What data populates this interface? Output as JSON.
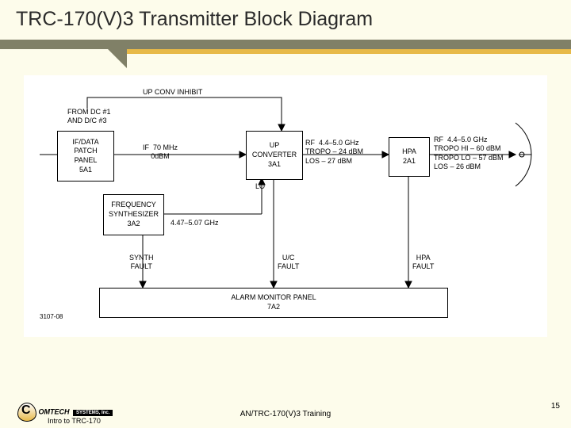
{
  "title": "TRC-170(V)3 Transmitter Block Diagram",
  "blocks": {
    "patch": {
      "l1": "IF/DATA",
      "l2": "PATCH",
      "l3": "PANEL",
      "l4": "5A1"
    },
    "synth": {
      "l1": "FREQUENCY",
      "l2": "SYNTHESIZER",
      "l3": "3A2"
    },
    "upconv": {
      "l1": "UP",
      "l2": "CONVERTER",
      "l3": "3A1"
    },
    "hpa": {
      "l1": "HPA",
      "l2": "2A1"
    },
    "alarm": {
      "l1": "ALARM MONITOR PANEL",
      "l2": "7A2"
    }
  },
  "notes": {
    "from": "FROM DC #1\nAND D/C #3",
    "inhibit": "UP CONV INHIBIT",
    "if70": "IF  70 MHz\n0dBM",
    "lo": "LO",
    "lofreq": "4.47–5.07 GHz",
    "postup": "RF  4.4–5.0 GHz\nTROPO – 24 dBM\nLOS – 27 dBM",
    "posthpa": "RF  4.4–5.0 GHz\nTROPO HI – 60 dBM\nTROPO LO – 57 dBM\nLOS – 26 dBM",
    "f_synth": "SYNTH\nFAULT",
    "f_uc": "U/C\nFAULT",
    "f_hpa": "HPA\nFAULT",
    "figno": "3107-08"
  },
  "footer": {
    "brand": "OMTECH",
    "sub": "SYSTEMS, Inc.",
    "left": "Intro to TRC-170",
    "center": "AN/TRC-170(V)3 Training",
    "page": "15"
  },
  "chart_data": {
    "type": "diagram",
    "title": "TRC-170(V)3 Transmitter Block Diagram",
    "nodes": [
      {
        "id": "5A1",
        "label": "IF/DATA PATCH PANEL 5A1",
        "inputs": [
          "FROM DC #1 AND D/C #3"
        ]
      },
      {
        "id": "3A2",
        "label": "FREQUENCY SYNTHESIZER 3A2",
        "output": "LO 4.47–5.07 GHz"
      },
      {
        "id": "3A1",
        "label": "UP CONVERTER 3A1"
      },
      {
        "id": "2A1",
        "label": "HPA 2A1"
      },
      {
        "id": "7A2",
        "label": "ALARM MONITOR PANEL 7A2"
      },
      {
        "id": "ANT",
        "label": "Antenna"
      }
    ],
    "edges": [
      {
        "from": "5A1",
        "to": "3A1",
        "label": "IF 70 MHz, 0 dBM"
      },
      {
        "from": "3A2",
        "to": "3A1",
        "label": "LO 4.47–5.07 GHz"
      },
      {
        "from": "3A1",
        "to": "2A1",
        "label": "RF 4.4–5.0 GHz; TROPO −24 dBM; LOS −27 dBM"
      },
      {
        "from": "2A1",
        "to": "ANT",
        "label": "RF 4.4–5.0 GHz; TROPO HI −60 dBM; TROPO LO −57 dBM; LOS −26 dBM"
      },
      {
        "from": "3A2",
        "to": "7A2",
        "label": "SYNTH FAULT"
      },
      {
        "from": "3A1",
        "to": "7A2",
        "label": "U/C FAULT"
      },
      {
        "from": "2A1",
        "to": "7A2",
        "label": "HPA FAULT"
      },
      {
        "from": "7A2",
        "to": "3A1",
        "label": "UP CONV INHIBIT"
      }
    ]
  }
}
